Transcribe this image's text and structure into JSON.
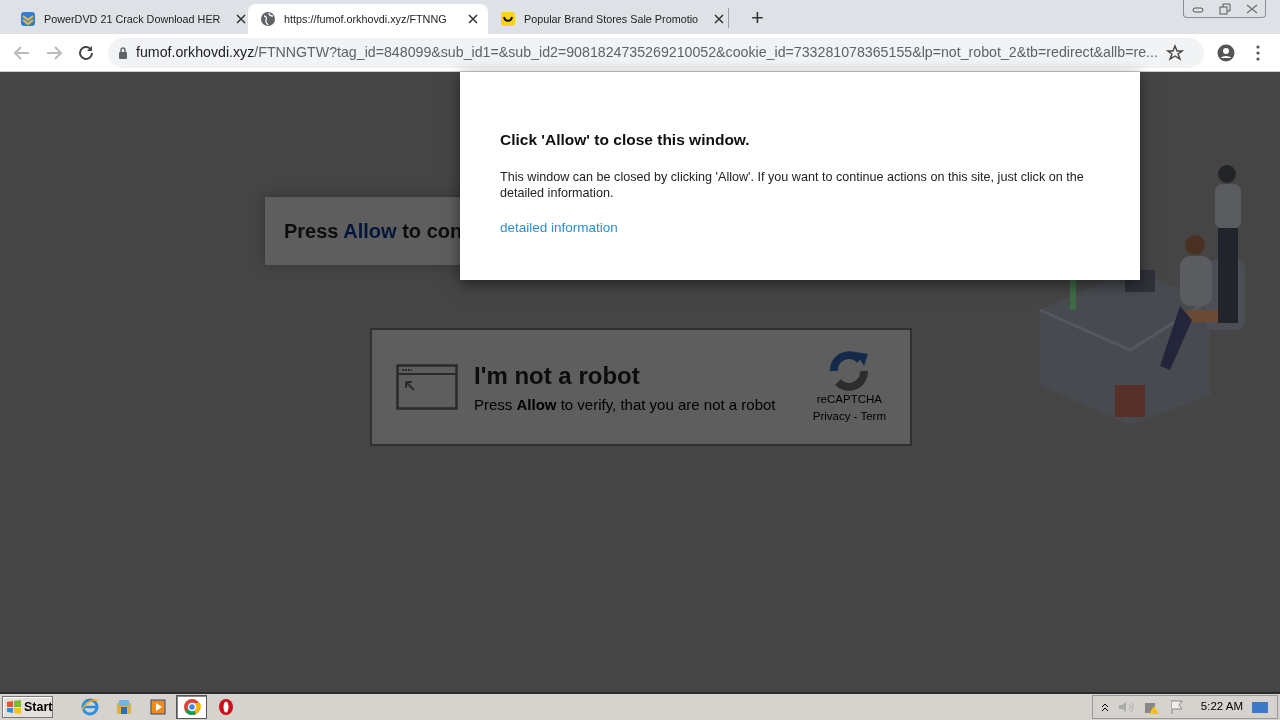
{
  "browser": {
    "tabs": [
      {
        "title": "PowerDVD 21 Crack Download HER",
        "selected": false
      },
      {
        "title": "https://fumof.orkhovdi.xyz/FTNNG",
        "selected": true
      },
      {
        "title": "Popular Brand Stores Sale Promotio",
        "selected": false
      }
    ],
    "new_tab": "+",
    "address": {
      "host": "fumof.orkhovdi.xyz",
      "path": "/FTNNGTW?tag_id=848099&sub_id1=&sub_id2=9081824735269210052&cookie_id=733281078365155&lp=not_robot_2&tb=redirect&allb=re..."
    }
  },
  "page": {
    "banner": {
      "before": "Press",
      "highlight": "Allow",
      "after": "to con"
    },
    "captcha": {
      "title": "I'm not a robot",
      "text": "Press **Allow** to verify, that you are not a robot",
      "brand": "reCAPTCHA",
      "links": "Privacy - Term"
    }
  },
  "dialog": {
    "title": "Click 'Allow' to close this window.",
    "body": "This window can be closed by clicking 'Allow'. If you want to continue actions on this site, just click on the detailed information.",
    "link": "detailed information"
  },
  "taskbar": {
    "start": "Start",
    "apps": [
      {
        "selected": false
      },
      {
        "selected": false
      },
      {
        "selected": false
      },
      {
        "selected": true
      },
      {
        "selected": false
      }
    ],
    "clock": "5:22 AM"
  }
}
